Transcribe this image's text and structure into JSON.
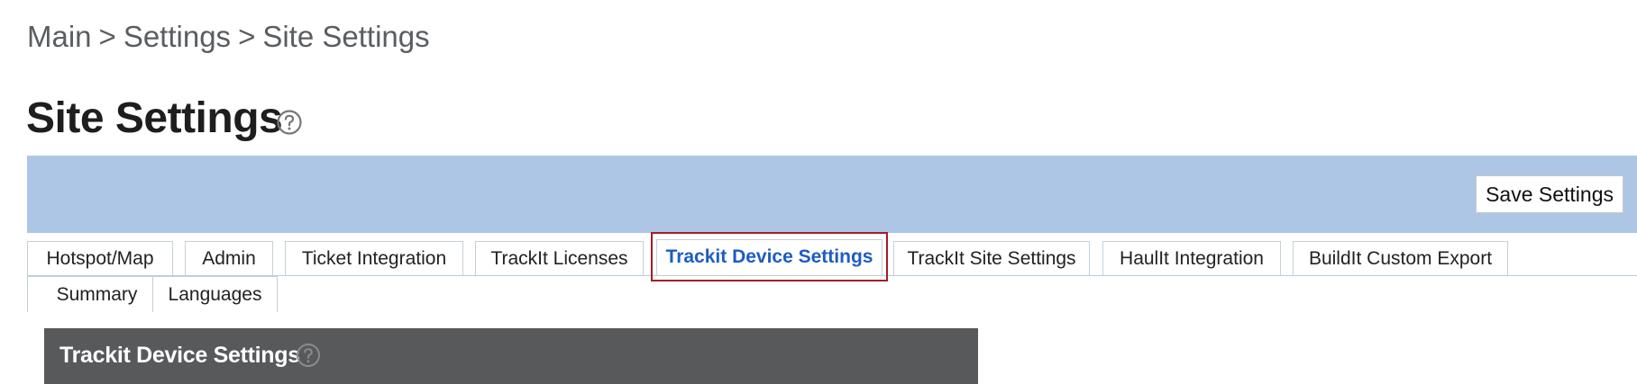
{
  "breadcrumb": {
    "items": [
      "Main",
      "Settings",
      "Site Settings"
    ],
    "separator": ">"
  },
  "page": {
    "title": "Site Settings",
    "help_icon": "question-circle-icon"
  },
  "toolbar": {
    "background": "#adc6e5",
    "save_label": "Save Settings"
  },
  "tabs": [
    {
      "label": "Hotspot/Map",
      "active": false
    },
    {
      "label": "Admin",
      "active": false
    },
    {
      "label": "Ticket Integration",
      "active": false
    },
    {
      "label": "TrackIt Licenses",
      "active": false
    },
    {
      "label": "Trackit Device Settings",
      "active": true
    },
    {
      "label": "TrackIt Site Settings",
      "active": false
    },
    {
      "label": "HaulIt Integration",
      "active": false
    },
    {
      "label": "BuildIt Custom Export",
      "active": false
    },
    {
      "label": "Summary",
      "active": false
    },
    {
      "label": "Languages",
      "active": false
    }
  ],
  "colors": {
    "active_tab_text": "#1d5cc2",
    "highlight_border": "#a31f24",
    "section_header_bg": "#58595b"
  },
  "section": {
    "title": "Trackit Device Settings",
    "help_icon": "question-circle-icon"
  }
}
